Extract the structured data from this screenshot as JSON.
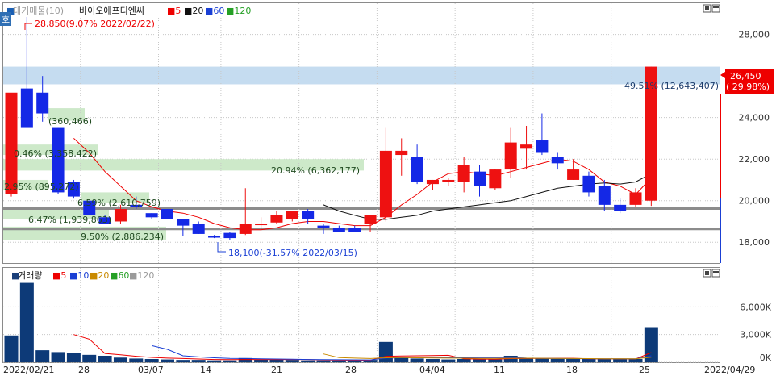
{
  "chart_data": [
    {
      "type": "candlestick",
      "legend": {
        "prefix": "대기매물(10)",
        "stock_name": "바이오에프디엔씨",
        "ma_labels": [
          "5",
          "20",
          "60",
          "120"
        ]
      },
      "x_tick_labels": [
        "2022/02/21",
        "28",
        "03/07",
        "14",
        "21",
        "28",
        "04/04",
        "11",
        "18",
        "25",
        "2022/04/29"
      ],
      "y_ticks": [
        18000,
        20000,
        22000,
        24000,
        26000,
        28000
      ],
      "y_tick_labels": [
        "18,000",
        "20,000",
        "22,000",
        "24,000",
        "26,000",
        "28,000"
      ],
      "ylim": [
        17000,
        29500
      ],
      "candles": [
        {
          "o": 20300,
          "h": 22000,
          "l": 20200,
          "c": 25200
        },
        {
          "o": 25400,
          "h": 28850,
          "l": 23500,
          "c": 23500
        },
        {
          "o": 25200,
          "h": 26000,
          "l": 23800,
          "c": 24200
        },
        {
          "o": 23500,
          "h": 23500,
          "l": 20300,
          "c": 20400
        },
        {
          "o": 20900,
          "h": 21000,
          "l": 20100,
          "c": 20200
        },
        {
          "o": 20000,
          "h": 20000,
          "l": 19300,
          "c": 19300
        },
        {
          "o": 19200,
          "h": 19300,
          "l": 18900,
          "c": 18900
        },
        {
          "o": 19000,
          "h": 19800,
          "l": 18900,
          "c": 19600
        },
        {
          "o": 19800,
          "h": 20200,
          "l": 19600,
          "c": 19700
        },
        {
          "o": 19400,
          "h": 19400,
          "l": 19100,
          "c": 19200
        },
        {
          "o": 19600,
          "h": 19600,
          "l": 19100,
          "c": 19100
        },
        {
          "o": 19100,
          "h": 19100,
          "l": 18300,
          "c": 18800
        },
        {
          "o": 18900,
          "h": 19000,
          "l": 18400,
          "c": 18400
        },
        {
          "o": 18300,
          "h": 18350,
          "l": 18200,
          "c": 18250
        },
        {
          "o": 18450,
          "h": 18500,
          "l": 18100,
          "c": 18200
        },
        {
          "o": 18400,
          "h": 20600,
          "l": 18350,
          "c": 18900
        },
        {
          "o": 18850,
          "h": 19200,
          "l": 18600,
          "c": 18900
        },
        {
          "o": 18950,
          "h": 19500,
          "l": 18900,
          "c": 19300
        },
        {
          "o": 19100,
          "h": 19500,
          "l": 19000,
          "c": 19500
        },
        {
          "o": 19500,
          "h": 19600,
          "l": 18900,
          "c": 19100
        },
        {
          "o": 18800,
          "h": 18900,
          "l": 18400,
          "c": 18700
        },
        {
          "o": 18700,
          "h": 18800,
          "l": 18500,
          "c": 18500
        },
        {
          "o": 18700,
          "h": 18800,
          "l": 18500,
          "c": 18500
        },
        {
          "o": 18900,
          "h": 19100,
          "l": 18500,
          "c": 19300
        },
        {
          "o": 19200,
          "h": 23500,
          "l": 19000,
          "c": 22400
        },
        {
          "o": 22200,
          "h": 23000,
          "l": 21200,
          "c": 22400
        },
        {
          "o": 22100,
          "h": 22700,
          "l": 20800,
          "c": 20900
        },
        {
          "o": 20800,
          "h": 21000,
          "l": 20500,
          "c": 21000
        },
        {
          "o": 20900,
          "h": 21100,
          "l": 20700,
          "c": 21000
        },
        {
          "o": 20900,
          "h": 22100,
          "l": 20400,
          "c": 21700
        },
        {
          "o": 21400,
          "h": 21700,
          "l": 20200,
          "c": 20700
        },
        {
          "o": 20600,
          "h": 21500,
          "l": 20500,
          "c": 21500
        },
        {
          "o": 21500,
          "h": 23500,
          "l": 21100,
          "c": 22800
        },
        {
          "o": 22500,
          "h": 23600,
          "l": 21500,
          "c": 22700
        },
        {
          "o": 22900,
          "h": 24200,
          "l": 22200,
          "c": 22300
        },
        {
          "o": 22100,
          "h": 22300,
          "l": 21500,
          "c": 21800
        },
        {
          "o": 21000,
          "h": 22000,
          "l": 21000,
          "c": 21500
        },
        {
          "o": 21200,
          "h": 21400,
          "l": 20200,
          "c": 20400
        },
        {
          "o": 20700,
          "h": 21000,
          "l": 19500,
          "c": 19800
        },
        {
          "o": 19800,
          "h": 20100,
          "l": 19400,
          "c": 19500
        },
        {
          "o": 19800,
          "h": 20600,
          "l": 19700,
          "c": 20400
        },
        {
          "o": 20000,
          "h": 26450,
          "l": 19750,
          "c": 26450
        }
      ],
      "ma5": [
        null,
        null,
        null,
        null,
        23000,
        22300,
        21400,
        20700,
        20000,
        19700,
        19500,
        19400,
        19200,
        18900,
        18700,
        18600,
        18600,
        18700,
        18900,
        19000,
        19000,
        18900,
        18800,
        18800,
        19200,
        19800,
        20300,
        20900,
        21300,
        21400,
        21300,
        21200,
        21400,
        21600,
        21800,
        22000,
        21900,
        21500,
        20900,
        20700,
        20300,
        21100
      ],
      "ma20": [
        null,
        null,
        null,
        null,
        null,
        null,
        null,
        null,
        null,
        null,
        null,
        null,
        null,
        null,
        null,
        null,
        null,
        null,
        null,
        null,
        19800,
        19500,
        19300,
        19100,
        19100,
        19200,
        19300,
        19500,
        19600,
        19700,
        19800,
        19900,
        20000,
        20200,
        20400,
        20600,
        20700,
        20800,
        20850,
        20800,
        20900,
        21300
      ],
      "resistance_zones": [
        {
          "text": "49.51% (12,643,407)",
          "from": 25600,
          "to": 26450
        },
        {
          "text": "0.46% (3,358,422)",
          "from": 22200,
          "to": 22700
        },
        {
          "text": "20.94% (6,362,177)",
          "from": 21450,
          "to": 22000
        },
        {
          "text": "2.95% (895,272)",
          "from": 20500,
          "to": 21000
        },
        {
          "text": "9.50% (2,886,234)",
          "from": 18100,
          "to": 18750
        }
      ],
      "support_zones": [
        {
          "text": "(360,466)",
          "from": 23850,
          "to": 24450
        },
        {
          "text": "6.59% (2,610,759)",
          "from": 19900,
          "to": 20400
        },
        {
          "text": "6.47% (1,939,863)",
          "from": 19100,
          "to": 19600
        }
      ],
      "annotations": {
        "high": "28,850(9.07% 2022/02/22)",
        "low": "18,100(-31.57% 2022/03/15)"
      },
      "last_price": {
        "value": "26,450",
        "change": "( 29.98%)"
      }
    },
    {
      "type": "bar",
      "legend": {
        "title": "거래량",
        "ma_labels": [
          "5",
          "10",
          "20",
          "60",
          "120"
        ]
      },
      "y_tick_labels": [
        "6,000K",
        "3,000K",
        "0K"
      ],
      "y_ticks": [
        6000,
        3000,
        0
      ],
      "ylim": [
        0,
        9000
      ],
      "values": [
        2900,
        8600,
        1300,
        1100,
        1000,
        800,
        700,
        500,
        400,
        350,
        300,
        250,
        250,
        200,
        200,
        450,
        300,
        300,
        250,
        200,
        200,
        200,
        200,
        250,
        2200,
        500,
        400,
        350,
        300,
        350,
        300,
        300,
        700,
        400,
        400,
        350,
        350,
        350,
        350,
        350,
        350,
        3800
      ],
      "ma5": [
        null,
        null,
        null,
        null,
        3000,
        2500,
        950,
        800,
        650,
        520,
        450,
        400,
        350,
        300,
        280,
        300,
        300,
        300,
        300,
        300,
        250,
        230,
        220,
        220,
        650,
        680,
        700,
        720,
        750,
        380,
        340,
        320,
        390,
        410,
        420,
        430,
        430,
        370,
        360,
        360,
        350,
        1050
      ],
      "ma10": [
        null,
        null,
        null,
        null,
        null,
        null,
        null,
        null,
        null,
        1800,
        1400,
        700,
        580,
        480,
        420,
        400,
        380,
        350,
        320,
        300,
        280,
        270,
        260,
        250,
        450,
        480,
        500,
        500,
        500,
        500,
        500,
        500,
        520,
        450,
        420,
        400,
        390,
        380,
        380,
        380,
        380,
        700
      ],
      "ma20": [
        null,
        null,
        null,
        null,
        null,
        null,
        null,
        null,
        null,
        null,
        null,
        null,
        null,
        null,
        null,
        null,
        null,
        null,
        null,
        null,
        900,
        500,
        450,
        400,
        480,
        500,
        480,
        460,
        450,
        440,
        420,
        420,
        430,
        440,
        430,
        420,
        400,
        390,
        380,
        380,
        380,
        550
      ]
    }
  ]
}
